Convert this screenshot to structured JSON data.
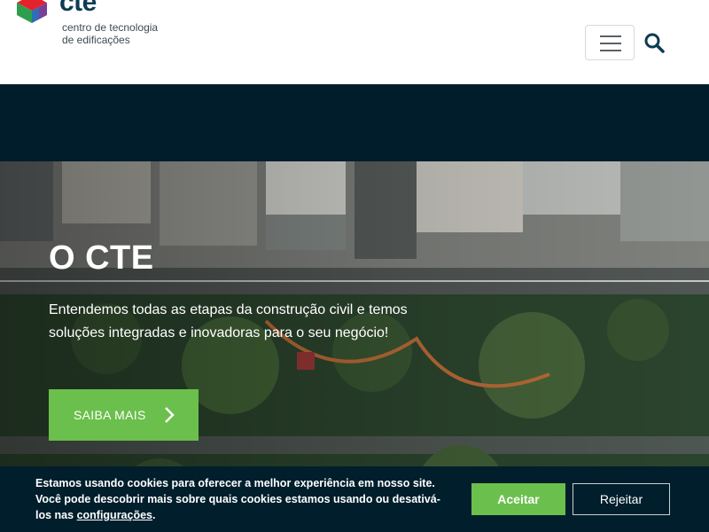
{
  "header": {
    "logo_word": "cte",
    "logo_subtitle_line1": "centro de tecnologia",
    "logo_subtitle_line2": "de edificações",
    "colors": {
      "logo_text": "#0d3b52"
    }
  },
  "hero": {
    "title": "O CTE",
    "description": "Entendemos todas as etapas da construção civil e temos soluções integradas e inovadoras para o seu negócio!",
    "cta_label": "SAIBA MAIS",
    "cta_icon": "chevron-right-icon",
    "colors": {
      "cta": "#6bbf4c",
      "band": "#011d2c"
    }
  },
  "cookie": {
    "line1": "Estamos usando cookies para oferecer a melhor experiência em nosso site.",
    "line2": "Você pode descobrir mais sobre quais cookies estamos usando ou desativá-los nas",
    "link_label": "configurações",
    "period": ".",
    "accept_label": "Aceitar",
    "reject_label": "Rejeitar",
    "colors": {
      "background": "#001e2c",
      "accept": "#6bbf4c"
    }
  },
  "icons": {
    "menu": "hamburger-icon",
    "search": "search-icon",
    "logo": "cube-logo-icon"
  }
}
